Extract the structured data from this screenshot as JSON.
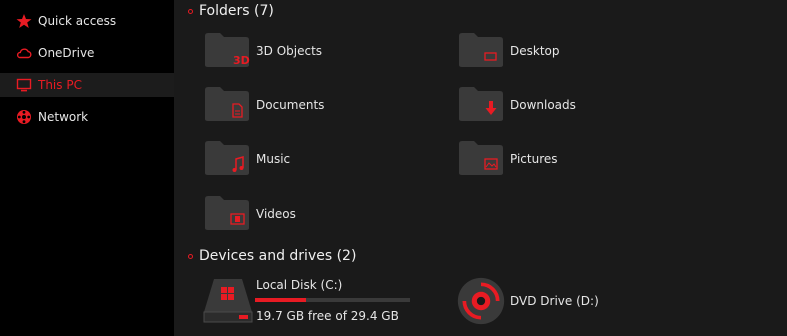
{
  "nav": {
    "items": [
      {
        "label": "Quick access",
        "icon": "star-icon"
      },
      {
        "label": "OneDrive",
        "icon": "cloud-icon"
      },
      {
        "label": "This PC",
        "icon": "monitor-icon",
        "selected": true
      },
      {
        "label": "Network",
        "icon": "network-icon"
      }
    ]
  },
  "folders": {
    "title": "Folders (7)",
    "items": [
      {
        "label": "3D Objects",
        "icon": "3d-objects-icon"
      },
      {
        "label": "Desktop",
        "icon": "desktop-icon"
      },
      {
        "label": "Documents",
        "icon": "documents-icon"
      },
      {
        "label": "Downloads",
        "icon": "downloads-icon"
      },
      {
        "label": "Music",
        "icon": "music-icon"
      },
      {
        "label": "Pictures",
        "icon": "pictures-icon"
      },
      {
        "label": "Videos",
        "icon": "videos-icon"
      }
    ]
  },
  "devices": {
    "title": "Devices and drives (2)",
    "items": [
      {
        "label": "Local Disk (C:)",
        "free_text": "19.7 GB free of 29.4 GB",
        "used_fraction": 0.33,
        "icon": "hard-disk-icon"
      },
      {
        "label": "DVD Drive (D:)",
        "icon": "dvd-drive-icon"
      }
    ]
  },
  "colors": {
    "accent": "#e81b23",
    "background": "#1a1a1a",
    "nav_background": "#000000",
    "folder": "#3a3a3a"
  }
}
